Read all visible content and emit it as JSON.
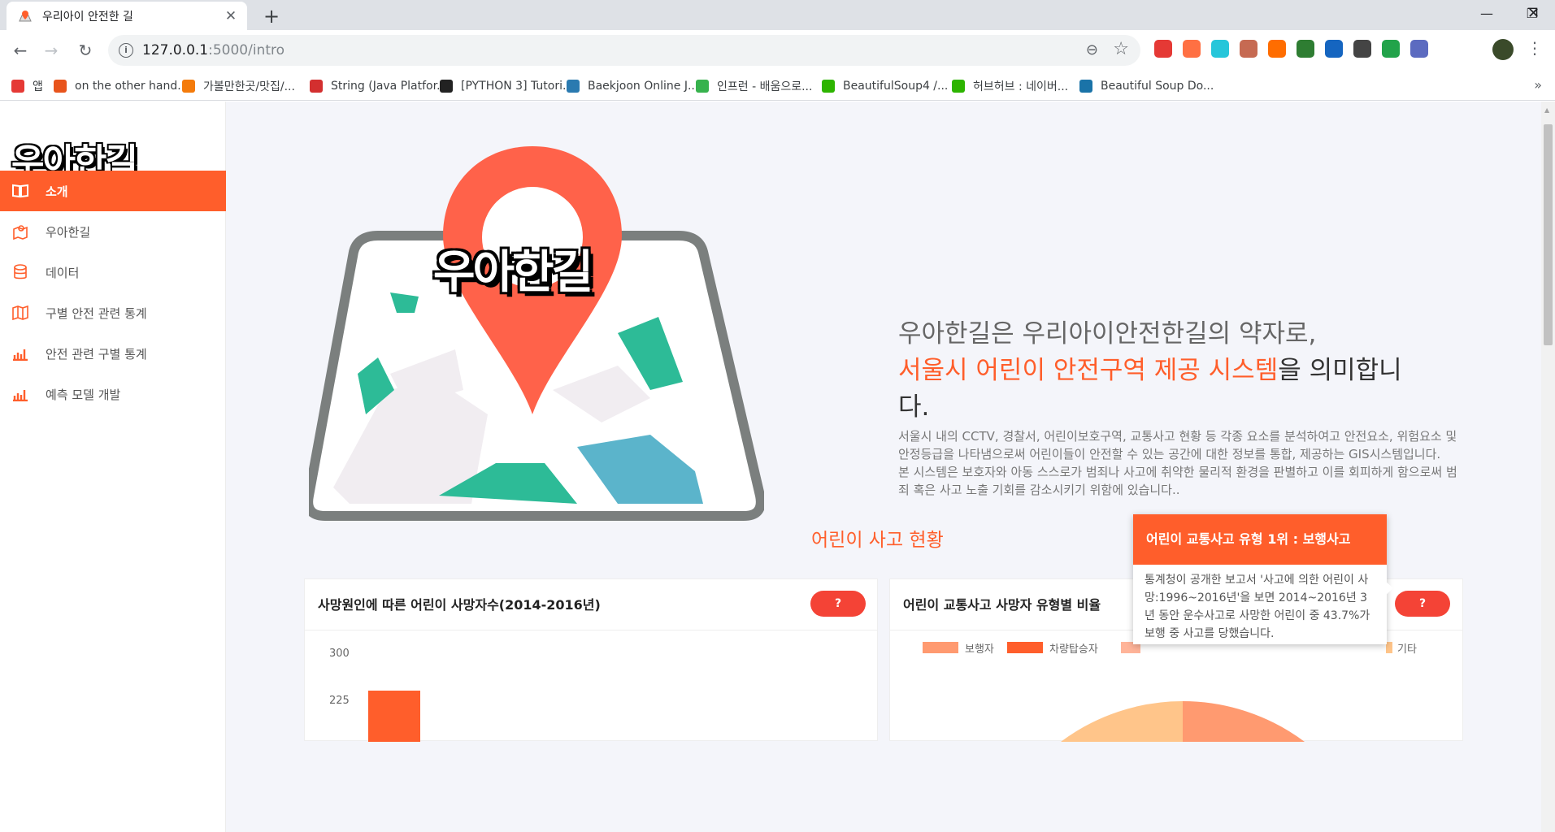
{
  "browser": {
    "tab_title": "우리아이 안전한 길",
    "url_host": "127.0.0.1",
    "url_path": ":5000/intro",
    "close_glyph": "✕",
    "new_tab_glyph": "+",
    "bookmarks": [
      {
        "label": "앱",
        "color": "#e53935"
      },
      {
        "label": "on the other hand...",
        "color": "#e8541c"
      },
      {
        "label": "가볼만한곳/맛집/...",
        "color": "#f47b0b"
      },
      {
        "label": "String (Java Platfor...",
        "color": "#d32f2f"
      },
      {
        "label": "[PYTHON 3] Tutori...",
        "color": "#222222"
      },
      {
        "label": "Baekjoon Online J...",
        "color": "#2a7ab0"
      },
      {
        "label": "인프런 - 배움으로...",
        "color": "#37b24d"
      },
      {
        "label": "BeautifulSoup4 /...",
        "color": "#2db400"
      },
      {
        "label": "허브허브 : 네이버...",
        "color": "#2db400"
      },
      {
        "label": "Beautiful Soup Do...",
        "color": "#1a73a8"
      }
    ],
    "extensions": [
      "#e53935",
      "#ff7043",
      "#26c6da",
      "#c66a52",
      "#ff6d00",
      "#2e7d32",
      "#1565c0",
      "#444444",
      "#22a34a",
      "#5c6bc0"
    ]
  },
  "sidebar": {
    "logo": "우아한길",
    "items": [
      {
        "label": "소개",
        "icon": "book-icon",
        "active": true
      },
      {
        "label": "우아한길",
        "icon": "map-pin-icon",
        "active": false
      },
      {
        "label": "데이터",
        "icon": "database-icon",
        "active": false
      },
      {
        "label": "구별 안전 관련 통계",
        "icon": "map-icon",
        "active": false
      },
      {
        "label": "안전 관련 구별 통계",
        "icon": "bar-chart-icon",
        "active": false
      },
      {
        "label": "예측 모델 개발",
        "icon": "bar-chart-icon",
        "active": false
      }
    ]
  },
  "hero": {
    "logo_text": "우아한길",
    "line1": "우아한길은 우리아이안전한길의 약자로,",
    "line2_accent": "서울시 어린이 안전구역 제공 시스템",
    "line2_rest": "을 의미합니",
    "line3": "다.",
    "para1": "서울시 내의 CCTV, 경찰서, 어린이보호구역, 교통사고 현황 등 각종 요소를 분석하여고 안전요소, 위험요소 및 안정등급을 나타냄으로써 어린이들이 안전할 수 있는 공간에 대한 정보를 통합, 제공하는 GIS시스템입니다.",
    "para2": "본 시스템은 보호자와 아동 스스로가 범죄나 사고에 취약한 물리적 환경을 판별하고 이를 회피하게 함으로써 범죄 혹은 사고 노출 기회를 감소시키기 위함에 있습니다.."
  },
  "section": {
    "title": "어린이 사고 현황"
  },
  "cards": [
    {
      "title": "사망원인에 따른 어린이 사망자수(2014-2016년)",
      "button": "?",
      "y_ticks": [
        "300",
        "225"
      ]
    },
    {
      "title": "어린이 교통사고 사망자 유형별 비율",
      "button": "?",
      "legend": [
        {
          "label": "보행자",
          "color": "#ff9a70"
        },
        {
          "label": "차량탑승자",
          "color": "#ff5e2b"
        },
        {
          "label": "기타",
          "color": "#ffc58a"
        }
      ]
    }
  ],
  "tooltip": {
    "header": "어린이 교통사고 유형 1위 : 보행사고",
    "body": "통계청이 공개한 보고서 '사고에 의한 어린이 사망:1996~2016년'을 보면 2014~2016년 3년 동안 운수사고로 사망한 어린이 중 43.7%가 보행 중 사고를 당했습니다."
  },
  "colors": {
    "accent": "#ff5e2b",
    "button": "#f44336"
  }
}
